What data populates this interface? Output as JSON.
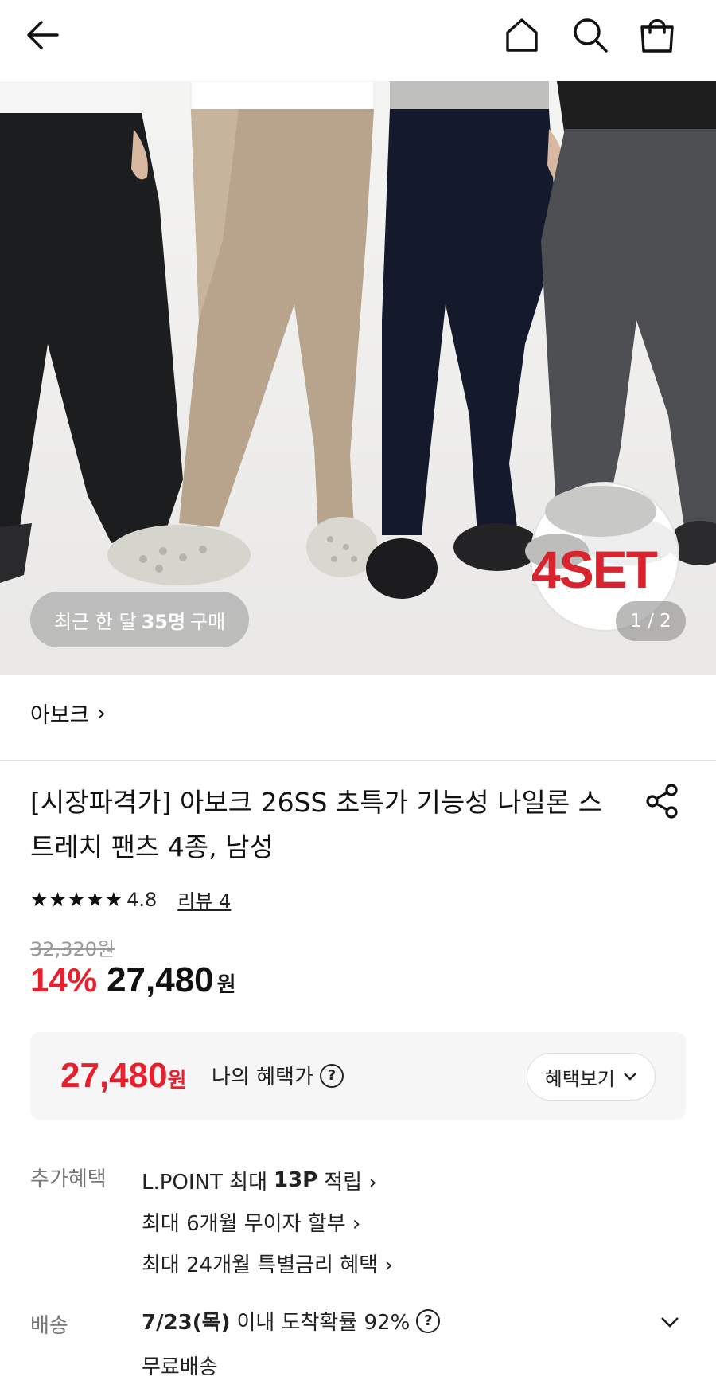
{
  "header": {
    "back_icon": "arrow-left-icon",
    "home_icon": "home-icon",
    "search_icon": "search-icon",
    "cart_icon": "shopping-bag-icon"
  },
  "hero": {
    "purchase_prefix": "최근 한 달",
    "purchase_count": "35명",
    "purchase_suffix": "구매",
    "set_label": "4SET",
    "page_indicator": "1 / 2"
  },
  "brand": {
    "name": "아보크",
    "chevron": "›"
  },
  "product": {
    "title": "[시장파격가] 아보크 26SS 초특가 기능성 나일론 스트레치 팬츠 4종, 남성",
    "share_icon": "share-icon",
    "stars": "★★★★★",
    "rating": "4.8",
    "review_label": "리뷰 4",
    "original_price": "32,320원",
    "discount": "14%",
    "sale_price": "27,480",
    "currency": "원"
  },
  "benefit": {
    "price": "27,480",
    "currency": "원",
    "label": "나의 혜택가",
    "help": "?",
    "button_label": "혜택보기",
    "button_chevron": "⌄"
  },
  "extra_benefits": {
    "label": "추가혜택",
    "items": [
      {
        "prefix": "L.POINT 최대",
        "bold": "13P",
        "suffix": "적립 ›"
      },
      {
        "prefix": "최대 6개월 무이자 할부 ›",
        "bold": "",
        "suffix": ""
      },
      {
        "prefix": "최대 24개월 특별금리 혜택 ›",
        "bold": "",
        "suffix": ""
      }
    ]
  },
  "delivery": {
    "label": "배송",
    "date": "7/23(목)",
    "text": "이내 도착확률 92%",
    "help": "?",
    "sub": "무료배송"
  },
  "colors": {
    "accent_red": "#e8202e",
    "text_dark": "#111111",
    "text_gray": "#777777"
  }
}
